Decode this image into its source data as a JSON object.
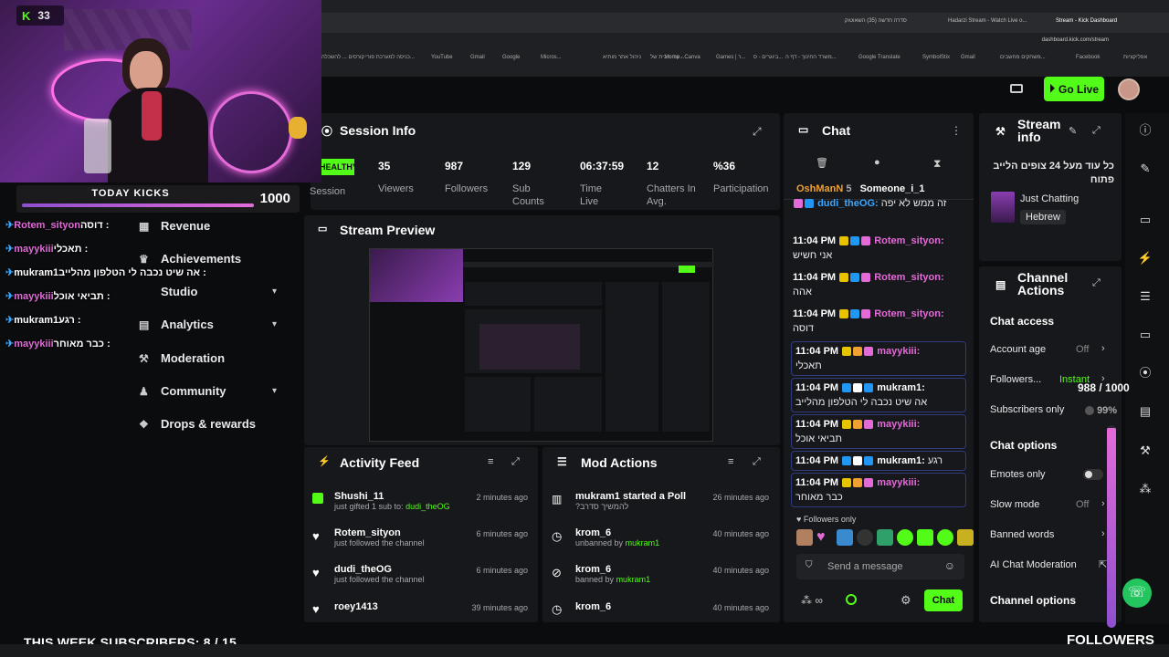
{
  "browser": {
    "tabs": [
      "סדרה חדשה (35) השאוטוק",
      "Hadarzi Stream - Watch Live o...",
      "Stream - Kick Dashboard"
    ],
    "url": "dashboard.kick.com/stream",
    "bookmarks": [
      "קורסים ... להשכלה",
      "כניסה למערכת פורי...",
      "YouTube",
      "Gmail",
      "Google",
      "Micros...",
      "ניהול אתר מותיא",
      "קוד הבית של...",
      "Home - Canva",
      "Games | ר...",
      "ביוגרים - ס...",
      "משרד החינוך - דף ה...",
      "Google Translate",
      "SymbolStix",
      "Gmail",
      "משחקים מחשבים...",
      "Facebook",
      "אפליקציות"
    ]
  },
  "header": {
    "go_live": "Go Live"
  },
  "overlay": {
    "kick_count": "33",
    "today_kicks_label": "TODAY KICKS",
    "today_kicks_value": "1000",
    "today_kicks_fraction": 1.0,
    "chat_lines": [
      {
        "user": "Rotem_sityon",
        "text": "דוסה :"
      },
      {
        "user": "mayykiii",
        "text": "תאכלי :"
      },
      {
        "user": "mukram1",
        "text": "אה שיט נכבה לי הטלפון מהלייב :"
      },
      {
        "user": "mayykiii",
        "text": "תביאי אוכל :"
      },
      {
        "user": "mukram1",
        "text": "רגע :"
      },
      {
        "user": "mayykiii",
        "text": "כבר מאוחר :"
      }
    ],
    "week_subscribers": "THIS WEEK SUBSCRIBERS: 8 / 15",
    "followers_label": "FOLLOWERS",
    "follower_goal": "988 / 1000",
    "follower_percent": "99%",
    "follower_fraction": 0.988
  },
  "nav": {
    "items": [
      "Revenue",
      "Achievements",
      "Studio",
      "Analytics",
      "Moderation",
      "Community",
      "Drops & rewards"
    ]
  },
  "session": {
    "title": "Session Info",
    "health": "HEALTHY",
    "health_label": "Session",
    "stats": [
      {
        "value": "35",
        "label": "Viewers"
      },
      {
        "value": "987",
        "label": "Followers"
      },
      {
        "value": "129",
        "label": "Sub Counts"
      },
      {
        "value": "06:37:59",
        "label": "Time Live"
      },
      {
        "value": "12",
        "label": "Chatters In Avg."
      },
      {
        "value": "%36",
        "label": "Participation"
      }
    ]
  },
  "preview": {
    "title": "Stream Preview"
  },
  "activity": {
    "title": "Activity Feed",
    "rows": [
      {
        "name": "Shushi_11",
        "sub": "just gifted 1 sub to:",
        "target": "dudi_theOG",
        "ago": "2 minutes ago"
      },
      {
        "name": "Rotem_sityon",
        "sub": "just followed the channel",
        "target": "",
        "ago": "6 minutes ago"
      },
      {
        "name": "dudi_theOG",
        "sub": "just followed the channel",
        "target": "",
        "ago": "6 minutes ago"
      },
      {
        "name": "roey1413",
        "sub": "",
        "target": "",
        "ago": "39 minutes ago"
      }
    ]
  },
  "mod": {
    "title": "Mod Actions",
    "rows": [
      {
        "name": "mukram1",
        "action": "started a Poll",
        "sub": "?להמשיך סדרב",
        "ago": "26 minutes ago"
      },
      {
        "name": "krom_6",
        "action": "",
        "sub": "unbanned by",
        "by": "mukram1",
        "ago": "40 minutes ago"
      },
      {
        "name": "krom_6",
        "action": "",
        "sub": "banned by",
        "by": "mukram1",
        "ago": "40 minutes ago"
      },
      {
        "name": "krom_6",
        "action": "",
        "sub": "",
        "by": "",
        "ago": "40 minutes ago"
      }
    ]
  },
  "chat": {
    "title": "Chat",
    "top_chatters": [
      "OshManN",
      "5",
      "Someone_i_1"
    ],
    "messages": [
      {
        "time": "",
        "user": "dudi_theOG:",
        "text": "זה ממש לא יפה",
        "boxed": false
      },
      {
        "time": "11:04 PM",
        "user": "Rotem_sityon:",
        "text": "אני חשיש",
        "boxed": false
      },
      {
        "time": "11:04 PM",
        "user": "Rotem_sityon:",
        "text": "אהה",
        "boxed": false
      },
      {
        "time": "11:04 PM",
        "user": "Rotem_sityon:",
        "text": "דוסה",
        "boxed": false
      },
      {
        "time": "11:04 PM",
        "user": "mayykiii:",
        "text": "תאכלי",
        "boxed": true
      },
      {
        "time": "11:04 PM",
        "user": "mukram1:",
        "text": "אה שיט נכבה לי הטלפון מהלייב",
        "boxed": true
      },
      {
        "time": "11:04 PM",
        "user": "mayykiii:",
        "text": "תביאי אוכל",
        "boxed": true
      },
      {
        "time": "11:04 PM",
        "user": "mukram1:",
        "text": "רגע",
        "boxed": true
      },
      {
        "time": "11:04 PM",
        "user": "mayykiii:",
        "text": "כבר מאוחר",
        "boxed": true
      }
    ],
    "followers_only": "Followers only",
    "placeholder": "Send a message",
    "send": "Chat"
  },
  "stream_info": {
    "title": "Stream info",
    "stream_title": "כל עוד מעל 24 צופים הלייב פתוח",
    "category": "Just Chatting",
    "language": "Hebrew"
  },
  "channel_actions": {
    "title": "Channel Actions",
    "chat_access": "Chat access",
    "account_age": "Account age",
    "account_age_val": "Off",
    "followers": "Followers...",
    "followers_val": "Instant",
    "subs_only": "Subscribers only",
    "chat_options": "Chat options",
    "emotes_only": "Emotes only",
    "slow_mode": "Slow mode",
    "slow_mode_val": "Off",
    "banned_words": "Banned words",
    "ai_moderation": "AI Chat Moderation",
    "channel_options": "Channel options"
  },
  "colors": {
    "kick_green": "#53fc18",
    "panel": "#17181b",
    "accent_pink": "#e36bd8"
  }
}
